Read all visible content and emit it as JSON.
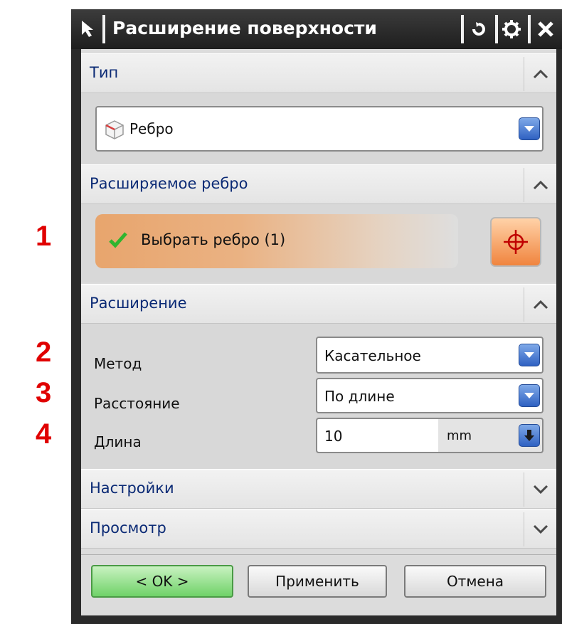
{
  "annotations": [
    "1",
    "2",
    "3",
    "4"
  ],
  "dialog": {
    "title": "Расширение поверхности",
    "sections": {
      "type": {
        "label": "Тип",
        "dropdown_value": "Ребро"
      },
      "edge": {
        "label": "Расширяемое ребро",
        "select_text": "Выбрать ребро (1)"
      },
      "extension": {
        "label": "Расширение",
        "method_label": "Метод",
        "method_value": "Касательное",
        "distance_label": "Расстояние",
        "distance_value": "По длине",
        "length_label": "Длина",
        "length_value": "10",
        "length_unit": "mm"
      },
      "settings": {
        "label": "Настройки"
      },
      "preview": {
        "label": "Просмотр"
      }
    },
    "buttons": {
      "ok": "< OK >",
      "apply": "Применить",
      "cancel": "Отмена"
    }
  },
  "icons": {
    "titlebar": [
      "select-arrow-icon",
      "reset-icon",
      "gear-icon",
      "close-icon"
    ],
    "section_toggles": [
      "chevron-up-icon",
      "chevron-down-icon"
    ],
    "misc": [
      "cube-icon",
      "check-icon",
      "crosshair-icon",
      "dropdown-arrow-icon"
    ]
  },
  "colors": {
    "annotation": "#e00000",
    "section_label": "#0b2a75",
    "select_row": "#e8a56d",
    "ok_button": "#6fd268"
  }
}
